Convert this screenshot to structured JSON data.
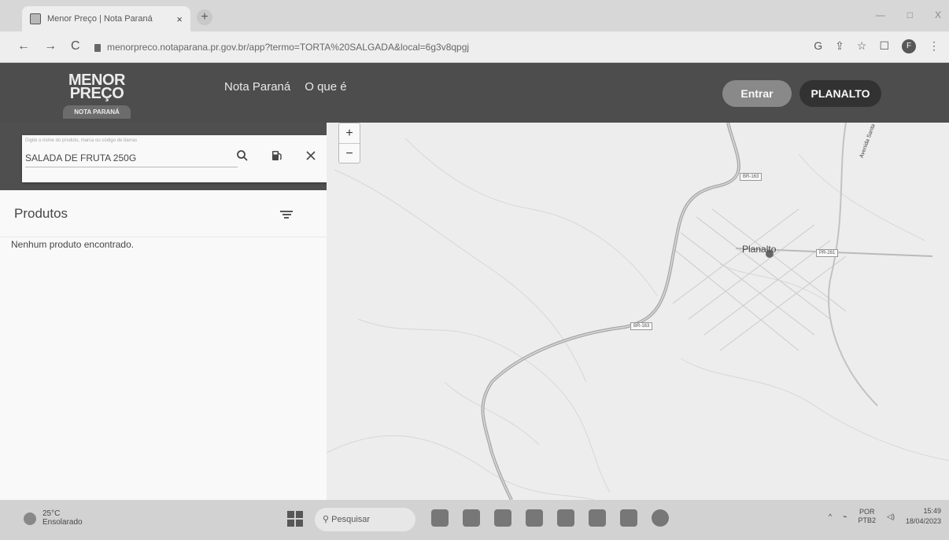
{
  "browser": {
    "tab_title": "Menor Preço | Nota Paraná",
    "tab_close": "×",
    "new_tab": "+",
    "url": "menorpreco.notaparana.pr.gov.br/app?termo=TORTA%20SALGADA&local=6g3v8qpgj",
    "nav": {
      "back": "←",
      "forward": "→",
      "reload": "C"
    },
    "window_controls": {
      "minimize": "—",
      "maximize": "□",
      "close": "X"
    },
    "toolbar_icons": {
      "google": "G",
      "share": "⇪",
      "bookmark": "☆",
      "sidepanel": "☐",
      "profile": "F",
      "menu": "⋮"
    }
  },
  "header": {
    "logo_line1": "MENOR",
    "logo_line2": "PREÇO",
    "logo_line3": "NOTA PARANÁ",
    "nav_items": [
      "Nota Paraná",
      "O que é"
    ],
    "login_button": "Entrar",
    "location_button": "PLANALTO"
  },
  "search": {
    "placeholder": "Digite o nome do produto, marca ou código de barras",
    "value": "SALADA DE FRUTA 250G",
    "icons": [
      "search-icon",
      "fuel-icon",
      "close-icon"
    ]
  },
  "results": {
    "title": "Produtos",
    "empty_message": "Nenhum produto encontrado."
  },
  "map": {
    "zoom_in": "+",
    "zoom_out": "−",
    "city_label": "Planalto",
    "road_labels": [
      "BR-163",
      "BR-163",
      "PR-281"
    ],
    "street_label": "Avenida Santa"
  },
  "taskbar": {
    "weather_temp": "25°C",
    "weather_desc": "Ensolarado",
    "search_label": "Pesquisar",
    "lang_line1": "POR",
    "lang_line2": "PTB2",
    "time": "15:49",
    "date": "18/04/2023"
  },
  "colors": {
    "header_bg": "#4a4a4a",
    "button_dark": "#2e2e2e",
    "button_gray": "#8a8a8a",
    "map_bg": "#f3f3f1"
  }
}
